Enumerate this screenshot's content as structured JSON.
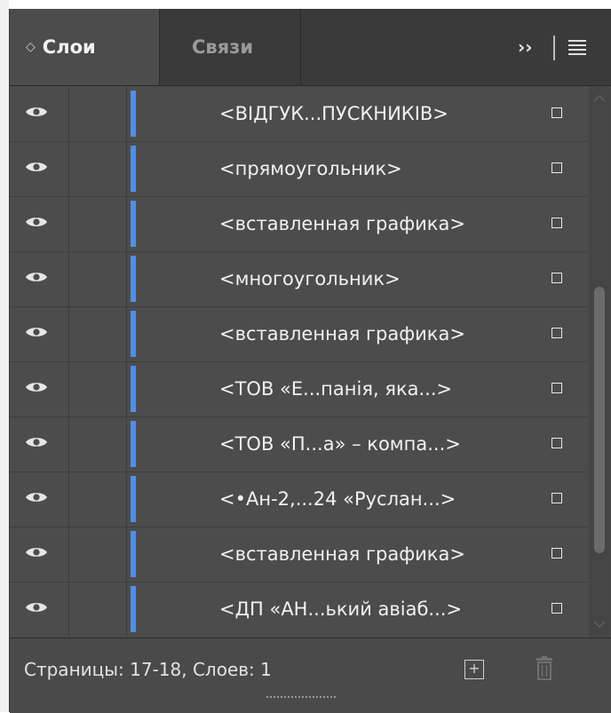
{
  "tabs": [
    {
      "label": "Слои",
      "active": true
    },
    {
      "label": "Связи",
      "active": false
    }
  ],
  "toolbar": {
    "expand_label": "››",
    "menu_icon": "hamburger-menu-icon"
  },
  "layers": {
    "items": [
      {
        "label": "<ВІДГУК...ПУСКНИКІВ>",
        "visible": true,
        "selected": false
      },
      {
        "label": "<прямоугольник>",
        "visible": true,
        "selected": false
      },
      {
        "label": "<вставленная графика>",
        "visible": true,
        "selected": false
      },
      {
        "label": "<многоугольник>",
        "visible": true,
        "selected": false
      },
      {
        "label": "<вставленная графика>",
        "visible": true,
        "selected": false
      },
      {
        "label": "<ТОВ «Е...панія, яка...>",
        "visible": true,
        "selected": false
      },
      {
        "label": "<ТОВ «П...а» – компа...>",
        "visible": true,
        "selected": false
      },
      {
        "label": "<•Ан-2,...24 «Руслан...>",
        "visible": true,
        "selected": false
      },
      {
        "label": "<вставленная графика>",
        "visible": true,
        "selected": false
      },
      {
        "label": "<ДП «АН...ький авіаб...>",
        "visible": true,
        "selected": false
      }
    ],
    "layer_color": "#4d8fef"
  },
  "footer": {
    "status": "Страницы: 17-18, Слоев: 1",
    "new_icon": "new-layer-icon",
    "delete_icon": "trash-icon"
  },
  "colors": {
    "panel_bg": "#4c4c4c",
    "tabbar_bg": "#3a3a3a",
    "text": "#f1f1f1"
  }
}
